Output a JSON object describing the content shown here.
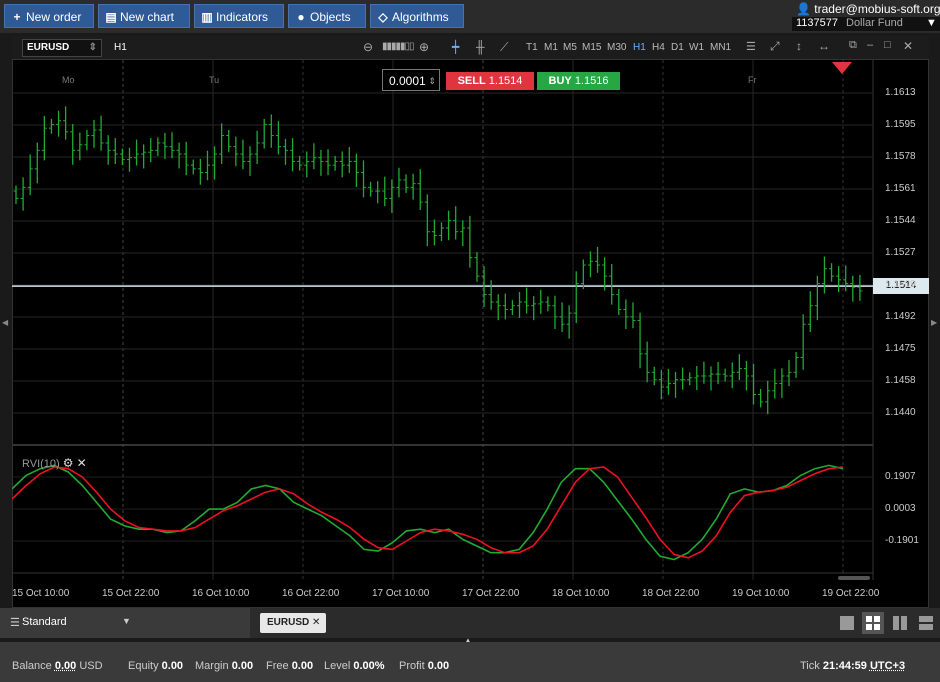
{
  "toolbar": {
    "new_order": "New order",
    "new_chart": "New chart",
    "indicators": "Indicators",
    "objects": "Objects",
    "algorithms": "Algorithms"
  },
  "account": {
    "user": "trader@mobius-soft.org",
    "id": "1137577",
    "name": "Dollar Fund"
  },
  "chart": {
    "symbol": "EURUSD",
    "timeframe": "H1",
    "timeframes": [
      "T1",
      "M1",
      "M5",
      "M15",
      "M30",
      "H1",
      "H4",
      "D1",
      "W1",
      "MN1"
    ],
    "active_timeframe": "H1",
    "quantity": "0.0001",
    "sell_label": "SELL",
    "sell_price": "1.1514",
    "buy_label": "BUY",
    "buy_price": "1.1516",
    "current_price": "1.1514",
    "days": [
      "Mo",
      "Tu",
      "Fr"
    ],
    "indicator_label": "RVI(10)"
  },
  "chart_data": {
    "type": "candlestick",
    "y_ticks": [
      "1.1613",
      "1.1595",
      "1.1578",
      "1.1561",
      "1.1544",
      "1.1527",
      "1.1509",
      "1.1492",
      "1.1475",
      "1.1458",
      "1.1440"
    ],
    "x_ticks": [
      "15 Oct 10:00",
      "15 Oct 22:00",
      "16 Oct 10:00",
      "16 Oct 22:00",
      "17 Oct 10:00",
      "17 Oct 22:00",
      "18 Oct 10:00",
      "18 Oct 22:00",
      "19 Oct 10:00",
      "19 Oct 22:00"
    ],
    "closes": [
      1.1556,
      1.1562,
      1.1572,
      1.1582,
      1.1594,
      1.1596,
      1.1598,
      1.1592,
      1.1582,
      1.1585,
      1.159,
      1.1593,
      1.1586,
      1.1582,
      1.158,
      1.1577,
      1.1578,
      1.158,
      1.1581,
      1.1582,
      1.1586,
      1.1584,
      1.1582,
      1.158,
      1.1574,
      1.1572,
      1.157,
      1.1574,
      1.158,
      1.159,
      1.1584,
      1.158,
      1.1576,
      1.158,
      1.1586,
      1.1596,
      1.159,
      1.1584,
      1.1582,
      1.1576,
      1.1574,
      1.1576,
      1.1578,
      1.1576,
      1.1574,
      1.1576,
      1.1574,
      1.1576,
      1.157,
      1.1562,
      1.156,
      1.156,
      1.1556,
      1.1562,
      1.1566,
      1.1562,
      1.1564,
      1.1554,
      1.1538,
      1.1536,
      1.154,
      1.1544,
      1.1538,
      1.154,
      1.1524,
      1.1514,
      1.1504,
      1.15,
      1.1498,
      1.1496,
      1.1498,
      1.15,
      1.1498,
      1.1499,
      1.15,
      1.1498,
      1.1492,
      1.1488,
      1.1494,
      1.151,
      1.152,
      1.1522,
      1.152,
      1.1514,
      1.1504,
      1.1496,
      1.1492,
      1.149,
      1.1472,
      1.1462,
      1.1458,
      1.1454,
      1.1456,
      1.1458,
      1.1458,
      1.1459,
      1.146,
      1.146,
      1.1461,
      1.1461,
      1.146,
      1.1462,
      1.1464,
      1.146,
      1.145,
      1.1446,
      1.1452,
      1.1456,
      1.146,
      1.1462,
      1.147,
      1.1488,
      1.1498,
      1.151,
      1.1518,
      1.1514,
      1.1512,
      1.151,
      1.1508,
      1.1506
    ],
    "rvi_ticks": [
      "0.1907",
      "0.0003",
      "-0.1901"
    ],
    "rvi": [
      0.12,
      0.2,
      0.24,
      0.26,
      0.22,
      0.14,
      0.04,
      -0.06,
      -0.1,
      -0.12,
      -0.12,
      -0.14,
      -0.13,
      -0.07,
      0.0,
      0.0,
      0.04,
      0.12,
      0.14,
      0.12,
      0.04,
      0.0,
      -0.04,
      -0.1,
      -0.16,
      -0.24,
      -0.25,
      -0.2,
      -0.13,
      -0.12,
      -0.14,
      -0.12,
      -0.18,
      -0.22,
      -0.26,
      -0.26,
      -0.24,
      -0.14,
      0.0,
      0.16,
      0.24,
      0.24,
      0.16,
      0.05,
      -0.06,
      -0.18,
      -0.28,
      -0.3,
      -0.26,
      -0.18,
      -0.06,
      0.09,
      0.12,
      0.1,
      0.11,
      0.14,
      0.2,
      0.24,
      0.26,
      0.24
    ],
    "rvi_signal": [
      0.06,
      0.14,
      0.21,
      0.25,
      0.24,
      0.19,
      0.1,
      0.0,
      -0.07,
      -0.11,
      -0.12,
      -0.13,
      -0.13,
      -0.11,
      -0.06,
      -0.01,
      0.02,
      0.06,
      0.1,
      0.12,
      0.09,
      0.03,
      -0.02,
      -0.06,
      -0.11,
      -0.18,
      -0.23,
      -0.24,
      -0.19,
      -0.14,
      -0.12,
      -0.13,
      -0.15,
      -0.18,
      -0.23,
      -0.26,
      -0.26,
      -0.22,
      -0.12,
      0.02,
      0.16,
      0.24,
      0.25,
      0.19,
      0.07,
      -0.05,
      -0.18,
      -0.27,
      -0.29,
      -0.25,
      -0.16,
      -0.02,
      0.08,
      0.1,
      0.11,
      0.13,
      0.17,
      0.21,
      0.24,
      0.25
    ],
    "colors": {
      "up": "#22aa33",
      "rvi": "#22aa33",
      "signal": "#ee1122",
      "price_line": "#cfe3ee"
    }
  },
  "bottom": {
    "layout": "Standard",
    "tab": "EURUSD"
  },
  "status": {
    "balance_label": "Balance",
    "balance": "0.00",
    "currency": "USD",
    "equity_label": "Equity",
    "equity": "0.00",
    "margin_label": "Margin",
    "margin": "0.00",
    "free_label": "Free",
    "free": "0.00",
    "level_label": "Level",
    "level": "0.00%",
    "profit_label": "Profit",
    "profit": "0.00",
    "tick_label": "Tick",
    "time": "21:44:59",
    "tz": "UTC+3"
  }
}
